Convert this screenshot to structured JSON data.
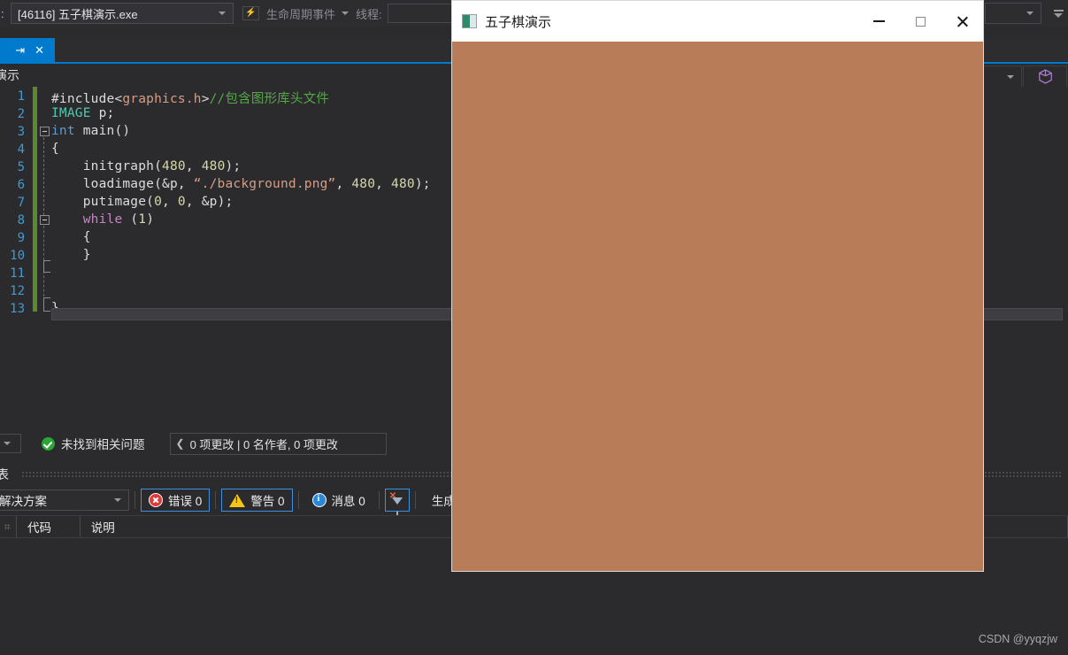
{
  "colors": {
    "ide_bg": "#2b2b2e",
    "toolbar_bg": "#2d2d30",
    "accent_blue": "#007acc",
    "change_bar_green": "#5b8a2c",
    "canvas_brown": "#b87c58",
    "error_red": "#e03b3b",
    "warning_yellow": "#f5c518",
    "info_blue": "#2b88d8",
    "ok_green": "#2aa636"
  },
  "debug_toolbar": {
    "prefix_label": ":",
    "process_value": "[46116] 五子棋演示.exe",
    "lifecycle_icon": "lifecycle-icon",
    "lifecycle_label": "生命周期事件",
    "thread_label": "线程:",
    "thread_value": "",
    "overflow_icon": "toolbar-overflow-icon",
    "dropdown_icon": "chevron-down-icon"
  },
  "tabs": {
    "active": {
      "pin_icon": "pin-icon",
      "close_icon": "close-icon"
    }
  },
  "navbar": {
    "breadcrumb": "子棋演示",
    "right_dropdown_value": "",
    "cube_icon": "cube-icon"
  },
  "editor": {
    "line_numbers": [
      "1",
      "2",
      "3",
      "4",
      "5",
      "6",
      "7",
      "8",
      "9",
      "10",
      "11",
      "12",
      "13"
    ],
    "lines": [
      {
        "n": 1,
        "segments": [
          {
            "t": "#include<",
            "c": "c-pre"
          },
          {
            "t": "graphics.h",
            "c": "c-str"
          },
          {
            "t": ">",
            "c": "c-pre"
          },
          {
            "t": "//包含图形库头文件",
            "c": "c-com"
          }
        ]
      },
      {
        "n": 2,
        "segments": [
          {
            "t": "IMAGE",
            "c": "c-type"
          },
          {
            "t": " p;",
            "c": "c-plain"
          }
        ]
      },
      {
        "n": 3,
        "segments": [
          {
            "t": "int",
            "c": "c-key"
          },
          {
            "t": " main()",
            "c": "c-plain"
          }
        ]
      },
      {
        "n": 4,
        "segments": [
          {
            "t": "{",
            "c": "c-plain"
          }
        ]
      },
      {
        "n": 5,
        "segments": [
          {
            "t": "    initgraph(",
            "c": "c-plain"
          },
          {
            "t": "480",
            "c": "c-num"
          },
          {
            "t": ", ",
            "c": "c-plain"
          },
          {
            "t": "480",
            "c": "c-num"
          },
          {
            "t": ");",
            "c": "c-plain"
          }
        ]
      },
      {
        "n": 6,
        "segments": [
          {
            "t": "    loadimage(&p, ",
            "c": "c-plain"
          },
          {
            "t": "“./background.png”",
            "c": "c-str"
          },
          {
            "t": ", ",
            "c": "c-plain"
          },
          {
            "t": "480",
            "c": "c-num"
          },
          {
            "t": ", ",
            "c": "c-plain"
          },
          {
            "t": "480",
            "c": "c-num"
          },
          {
            "t": ");",
            "c": "c-plain"
          }
        ]
      },
      {
        "n": 7,
        "segments": [
          {
            "t": "    putimage(",
            "c": "c-plain"
          },
          {
            "t": "0",
            "c": "c-num"
          },
          {
            "t": ", ",
            "c": "c-plain"
          },
          {
            "t": "0",
            "c": "c-num"
          },
          {
            "t": ", &p);",
            "c": "c-plain"
          }
        ]
      },
      {
        "n": 8,
        "segments": [
          {
            "t": "    ",
            "c": "c-plain"
          },
          {
            "t": "while",
            "c": "c-kw2"
          },
          {
            "t": " (",
            "c": "c-plain"
          },
          {
            "t": "1",
            "c": "c-num"
          },
          {
            "t": ")",
            "c": "c-plain"
          }
        ]
      },
      {
        "n": 9,
        "segments": [
          {
            "t": "    {",
            "c": "c-plain"
          }
        ]
      },
      {
        "n": 10,
        "segments": [
          {
            "t": "    }",
            "c": "c-plain"
          }
        ]
      },
      {
        "n": 11,
        "segments": []
      },
      {
        "n": 12,
        "segments": []
      },
      {
        "n": 13,
        "segments": [
          {
            "t": "}",
            "c": "c-plain"
          }
        ]
      }
    ],
    "fold_markers": [
      3,
      8
    ],
    "horizontal_scrollbar": "editor-hscrollbar"
  },
  "analyzer_bar": {
    "dropdown_icon": "chevron-down-icon",
    "status_icon": "success-check-icon",
    "status_text": "未找到相关问题",
    "codelens_chevron": "chevron-left-icon",
    "codelens_text": "0 项更改 | 0 名作者, 0 项更改"
  },
  "error_panel": {
    "title": "表",
    "solution_scope": "解决方案",
    "solution_caret": "chevron-down-icon",
    "severity_buttons": [
      {
        "name": "errors-filter",
        "icon": "error-icon",
        "label": "错误 0",
        "active": true
      },
      {
        "name": "warnings-filter",
        "icon": "warning-icon",
        "label": "警告 0",
        "active": true
      },
      {
        "name": "messages-filter",
        "icon": "info-icon",
        "label": "消息 0",
        "active": false
      }
    ],
    "clear_filter_icon": "clear-filter-icon",
    "build_label": "生成",
    "columns": [
      "代码",
      "说明"
    ],
    "rows": []
  },
  "popup_window": {
    "title": "五子棋演示",
    "app_icon": "easyx-app-icon",
    "minimize_icon": "minimize-icon",
    "maximize_icon": "maximize-icon",
    "close_icon": "close-icon",
    "canvas_color": "#b87c58",
    "canvas_size": "480 x 480"
  },
  "watermark": "CSDN @yyqzjw"
}
